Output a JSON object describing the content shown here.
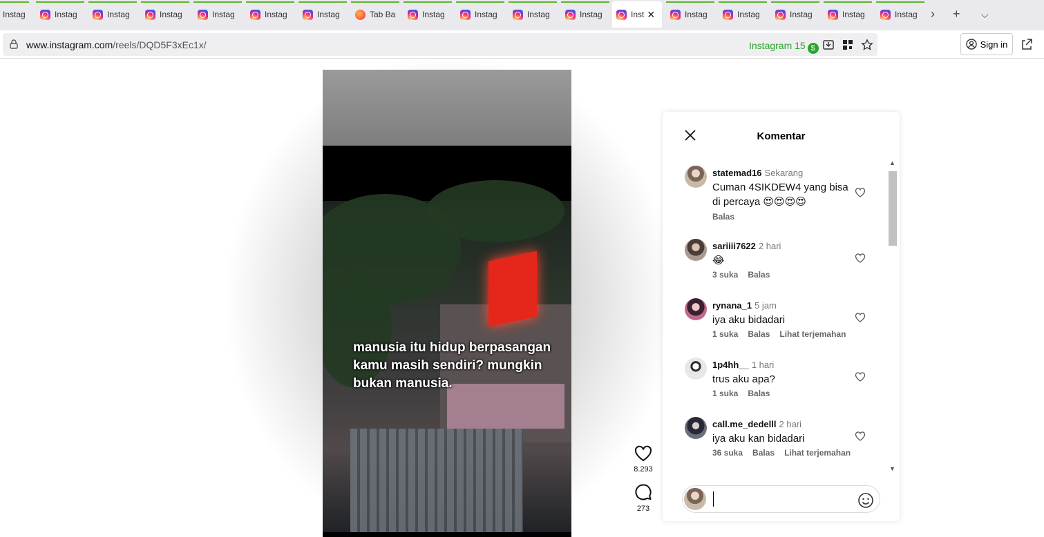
{
  "browser": {
    "tabs": [
      {
        "label": "Instag",
        "type": "instagram"
      },
      {
        "label": "Instag",
        "type": "instagram"
      },
      {
        "label": "Instag",
        "type": "instagram"
      },
      {
        "label": "Instag",
        "type": "instagram"
      },
      {
        "label": "Instag",
        "type": "instagram"
      },
      {
        "label": "Instag",
        "type": "instagram"
      },
      {
        "label": "Instag",
        "type": "instagram"
      },
      {
        "label": "Tab Ba",
        "type": "firefox"
      },
      {
        "label": "Instag",
        "type": "instagram"
      },
      {
        "label": "Instag",
        "type": "instagram"
      },
      {
        "label": "Instag",
        "type": "instagram"
      },
      {
        "label": "Instag",
        "type": "instagram"
      },
      {
        "label": "Inst",
        "type": "instagram",
        "active": true
      },
      {
        "label": "Instag",
        "type": "instagram"
      },
      {
        "label": "Instag",
        "type": "instagram"
      },
      {
        "label": "Instag",
        "type": "instagram"
      },
      {
        "label": "Instag",
        "type": "instagram"
      },
      {
        "label": "Instag",
        "type": "instagram"
      }
    ],
    "url_host": "www.instagram.com",
    "url_path": "/reels/DQD5F3xEc1x/",
    "site_badge_label": "Instagram 15",
    "site_badge_symbol": "$",
    "sign_in": "Sign in"
  },
  "video": {
    "caption": "manusia itu hidup berpasangan kamu masih sendiri? mungkin bukan manusia.",
    "likes": "8.293",
    "comments": "273"
  },
  "comments_panel": {
    "title": "Komentar",
    "items": [
      {
        "user": "statemad16",
        "time": "Sekarang",
        "text": "Cuman 4SIKDEW4 yang bisa di percaya",
        "emoji": "😍😍😍😍",
        "likes": "",
        "reply": "Balas",
        "translate": ""
      },
      {
        "user": "sariiii7622",
        "time": "2 hari",
        "text": "",
        "emoji": "😂",
        "likes": "3 suka",
        "reply": "Balas",
        "translate": ""
      },
      {
        "user": "rynana_1",
        "time": "5 jam",
        "text": "iya aku bidadari",
        "emoji": "",
        "likes": "1 suka",
        "reply": "Balas",
        "translate": "Lihat terjemahan"
      },
      {
        "user": "1p4hh__",
        "time": "1 hari",
        "text": "trus aku apa?",
        "emoji": "",
        "likes": "1 suka",
        "reply": "Balas",
        "translate": ""
      },
      {
        "user": "call.me_dedelll",
        "time": "2 hari",
        "text": "iya aku kan bidadari",
        "emoji": "",
        "likes": "36 suka",
        "reply": "Balas",
        "translate": "Lihat terjemahan"
      }
    ],
    "input_value": ""
  },
  "colors": {
    "accent_green": "#5ab52a",
    "instagram_red": "#e5261b"
  }
}
